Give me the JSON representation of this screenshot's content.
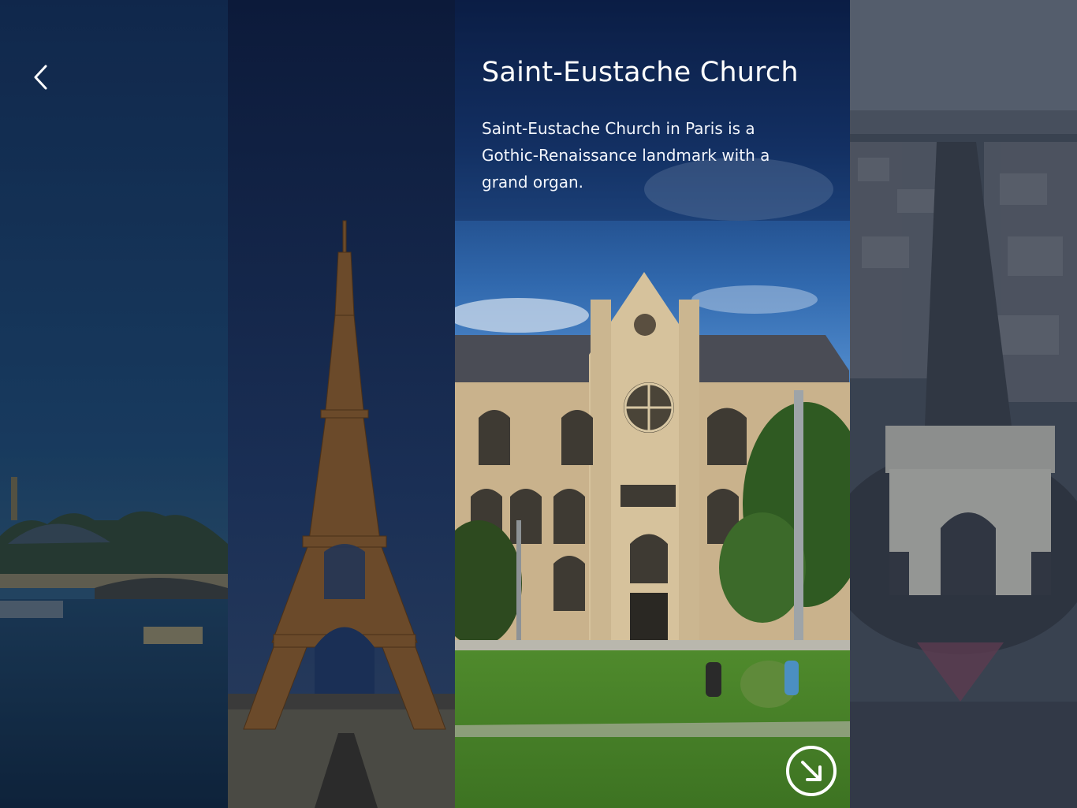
{
  "screen": {
    "back_icon": "chevron-left-icon",
    "open_icon": "arrow-down-right-circle-icon"
  },
  "panels": [
    {
      "id": "seine",
      "active": false
    },
    {
      "id": "eiffel",
      "active": false
    },
    {
      "id": "saint-eustache",
      "active": true
    },
    {
      "id": "arc",
      "active": false
    }
  ],
  "featured": {
    "title": "Saint-Eustache Church",
    "description": "Saint-Eustache Church in Paris is a Gothic-Renaissance landmark with a grand organ."
  },
  "colors": {
    "overlay": "#0d2347",
    "sky": "#2b5f9e",
    "text": "#ffffff"
  }
}
